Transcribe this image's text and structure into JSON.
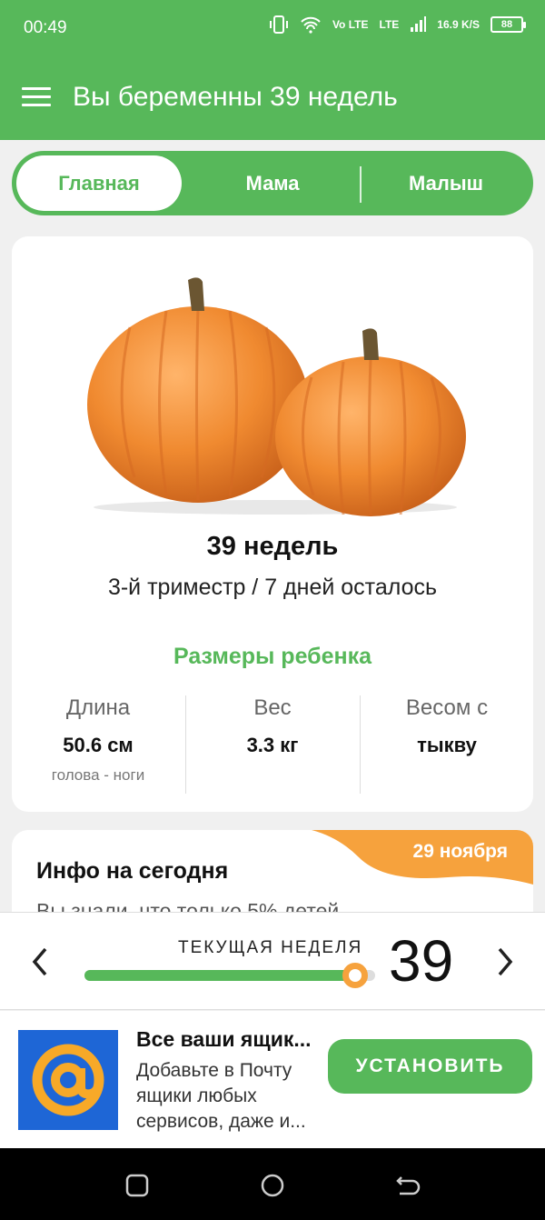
{
  "status": {
    "time": "00:49",
    "network": "Vo LTE",
    "lte": "LTE",
    "speed": "16.9",
    "speed_unit": "K/S",
    "battery": "88"
  },
  "appbar": {
    "title": "Вы беременны 39 недель"
  },
  "tabs": [
    {
      "label": "Главная"
    },
    {
      "label": "Мама"
    },
    {
      "label": "Малыш"
    }
  ],
  "week_card": {
    "week_title": "39 недель",
    "trimester": "3-й триместр / 7 дней осталось",
    "sizes_title": "Размеры ребенка",
    "stats": [
      {
        "label": "Длина",
        "value": "50.6 см",
        "sub": "голова - ноги"
      },
      {
        "label": "Вес",
        "value": "3.3 кг"
      },
      {
        "label": "Весом с",
        "value": "тыкву"
      }
    ]
  },
  "info_card": {
    "date": "29 ноября",
    "title": "Инфо на сегодня",
    "text": "Вы знали, что только 5% детей"
  },
  "week_nav": {
    "label": "ТЕКУЩАЯ НЕДЕЛЯ",
    "week": "39",
    "progress": 0.93
  },
  "ad": {
    "title": "Все ваши ящик...",
    "description": "Добавьте в Почту ящики любых сервисов, даже и...",
    "button": "УСТАНОВИТЬ"
  },
  "colors": {
    "green": "#57b85a",
    "orange": "#f6a23d"
  },
  "icons": [
    "menu-icon",
    "vibrate-icon",
    "wifi-icon",
    "signal-icon",
    "battery-icon",
    "chevron-left-icon",
    "chevron-right-icon",
    "mail-at-icon",
    "recent-apps-icon",
    "home-icon",
    "back-icon"
  ]
}
